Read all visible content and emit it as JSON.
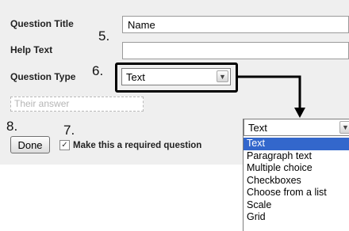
{
  "form": {
    "question_title_label": "Question Title",
    "question_title_value": "Name",
    "help_text_label": "Help Text",
    "help_text_value": "",
    "question_type_label": "Question Type",
    "question_type_value": "Text",
    "answer_placeholder": "Their answer",
    "done_label": "Done",
    "required_label": "Make this a required question",
    "required_checked": true
  },
  "steps": {
    "five": "5.",
    "six": "6.",
    "seven": "7.",
    "eight": "8."
  },
  "dropdown": {
    "selected": "Text",
    "options": [
      "Text",
      "Paragraph text",
      "Multiple choice",
      "Checkboxes",
      "Choose from a list",
      "Scale",
      "Grid"
    ]
  },
  "icons": {
    "select_arrow": "chevron-down-icon",
    "checkbox_check": "check-icon",
    "callout_arrow": "arrow-right-down-icon"
  },
  "colors": {
    "panel_background": "#efefef",
    "highlight": "#3367cc",
    "annotation": "#000000"
  }
}
